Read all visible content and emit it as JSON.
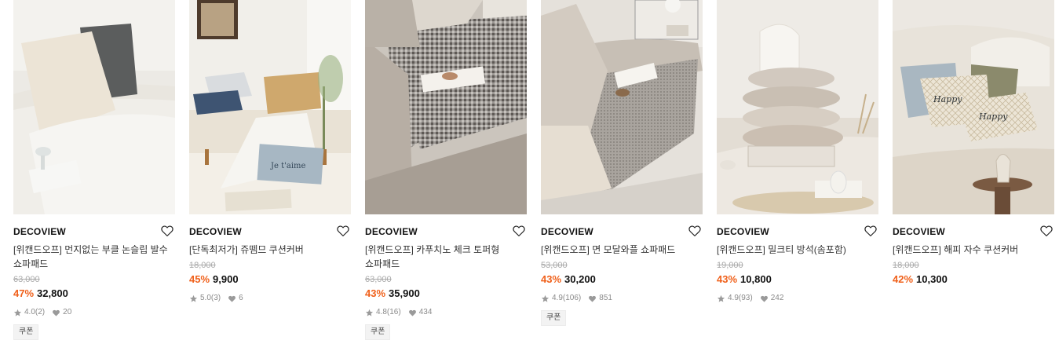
{
  "products": [
    {
      "brand": "DECOVIEW",
      "title": "[위캔드오프] 먼지없는 부클 논슬립 발수 쇼파패드",
      "original_price": "63,000",
      "discount": "47%",
      "price": "32,800",
      "rating": "4.0",
      "reviews": "(2)",
      "likes": "20",
      "coupon": "쿠폰"
    },
    {
      "brand": "DECOVIEW",
      "title": "[단독최저가] 쥬뗌므 쿠션커버",
      "original_price": "18,000",
      "discount": "45%",
      "price": "9,900",
      "rating": "5.0",
      "reviews": "(3)",
      "likes": "6"
    },
    {
      "brand": "DECOVIEW",
      "title": "[위캔드오프] 카푸치노 체크 토퍼형 쇼파패드",
      "original_price": "63,000",
      "discount": "43%",
      "price": "35,900",
      "rating": "4.8",
      "reviews": "(16)",
      "likes": "434",
      "coupon": "쿠폰"
    },
    {
      "brand": "DECOVIEW",
      "title": "[위캔드오프] 면 모달와플 쇼파패드",
      "original_price": "53,000",
      "discount": "43%",
      "price": "30,200",
      "rating": "4.9",
      "reviews": "(106)",
      "likes": "851",
      "coupon": "쿠폰"
    },
    {
      "brand": "DECOVIEW",
      "title": "[위캔드오프] 밀크티 방석(솜포함)",
      "original_price": "19,000",
      "discount": "43%",
      "price": "10,800",
      "rating": "4.9",
      "reviews": "(93)",
      "likes": "242"
    },
    {
      "brand": "DECOVIEW",
      "title": "[위캔드오프] 해피 자수 쿠션커버",
      "original_price": "18,000",
      "discount": "42%",
      "price": "10,300"
    }
  ],
  "image_texts": {
    "pillow_2": "Je t'aime",
    "pillow_6a": "Happy",
    "pillow_6b": "Happy"
  },
  "icons": {
    "wishlist": "heart-outline-icon",
    "rating": "star-icon",
    "likes": "heart-filled-icon"
  },
  "colors": {
    "discount": "#f0601a",
    "muted": "#8a8a8a",
    "coupon_bg": "#f3f3f3"
  }
}
